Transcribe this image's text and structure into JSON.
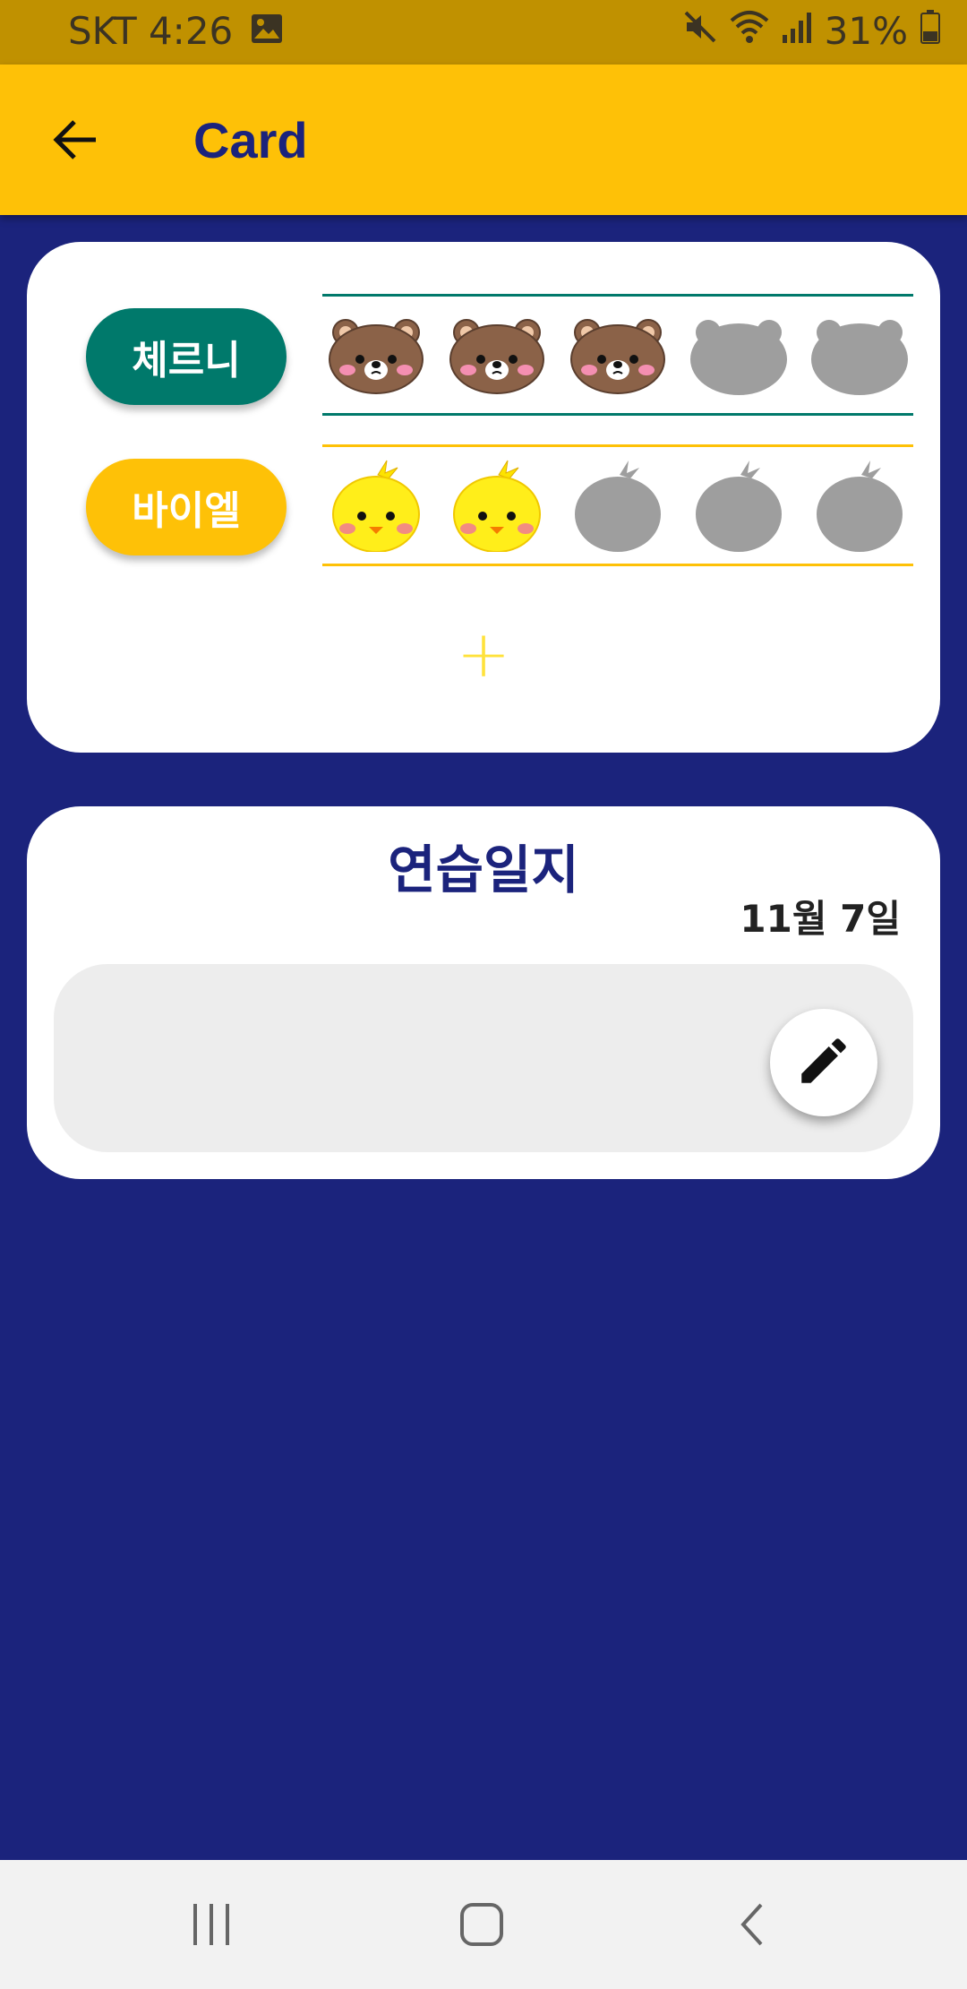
{
  "status_bar": {
    "carrier_time": "SKT 4:26",
    "battery": "31%",
    "icons": [
      "image-icon",
      "mute-icon",
      "wifi-icon",
      "signal-icon",
      "battery-icon"
    ]
  },
  "app_bar": {
    "title": "Card",
    "back_icon": "arrow-left-icon",
    "color": "#fec107",
    "title_color": "#1b237c"
  },
  "counter_card": {
    "rows": [
      {
        "label": "체르니",
        "pill_color": "#00796b",
        "line_color": "#00796b",
        "icon_type": "bear",
        "filled": 3,
        "total": 5
      },
      {
        "label": "바이엘",
        "pill_color": "#fec107",
        "line_color": "#fec107",
        "icon_type": "chick",
        "filled": 2,
        "total": 5
      }
    ],
    "add_label": "+"
  },
  "practice_log": {
    "title": "연습일지",
    "date": "11월 7일",
    "edit_icon": "pencil-icon"
  },
  "nav_bar": {
    "icons": [
      "recent-apps-icon",
      "home-icon",
      "back-nav-icon"
    ]
  },
  "colors": {
    "background": "#1b237c",
    "status_bar": "#c09100",
    "placeholder": "#9e9e9e"
  }
}
